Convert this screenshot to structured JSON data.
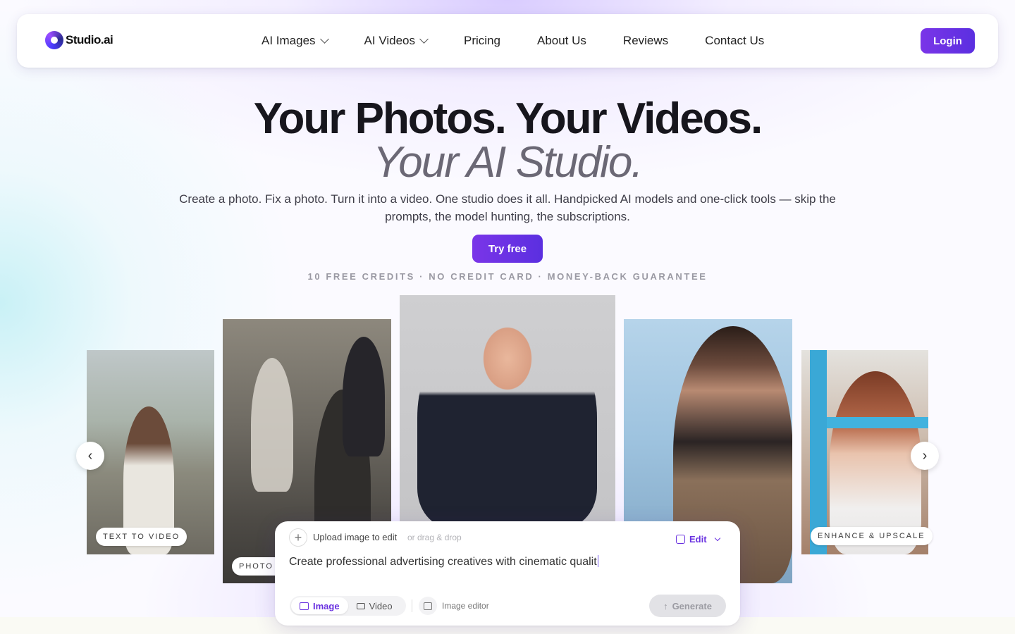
{
  "brand": {
    "name": "Studio.ai"
  },
  "nav": {
    "items": [
      {
        "label": "AI Images",
        "dropdown": true
      },
      {
        "label": "AI Videos",
        "dropdown": true
      },
      {
        "label": "Pricing"
      },
      {
        "label": "About Us"
      },
      {
        "label": "Reviews"
      },
      {
        "label": "Contact Us"
      }
    ],
    "login_label": "Login"
  },
  "hero": {
    "title_line1": "Your Photos. Your Videos.",
    "title_line2": "Your AI Studio.",
    "subtitle": "Create a photo. Fix a photo. Turn it into a video. One studio does it all. Handpicked AI models and one-click tools — skip the prompts, the model hunting, the subscriptions.",
    "cta_label": "Try free",
    "guarantee": "10 FREE CREDITS · NO CREDIT CARD · MONEY-BACK GUARANTEE"
  },
  "carousel": {
    "tags": {
      "card1": "TEXT TO VIDEO",
      "card2": "PHOTO R",
      "card5": "ENHANCE & UPSCALE"
    },
    "prev_icon": "‹",
    "next_icon": "›"
  },
  "prompt_panel": {
    "upload_label": "Upload image to edit",
    "drag_hint": "or drag & drop",
    "mode_label": "Edit",
    "prompt_text": "Create professional advertising creatives with cinematic qualit",
    "tab_image": "Image",
    "tab_video": "Video",
    "image_editor_label": "Image editor",
    "generate_label": "Generate",
    "generate_icon": "↑"
  },
  "colors": {
    "accent": "#6a32e0",
    "accent_gradient_start": "#7a35e8",
    "accent_gradient_end": "#5b2fe0"
  }
}
